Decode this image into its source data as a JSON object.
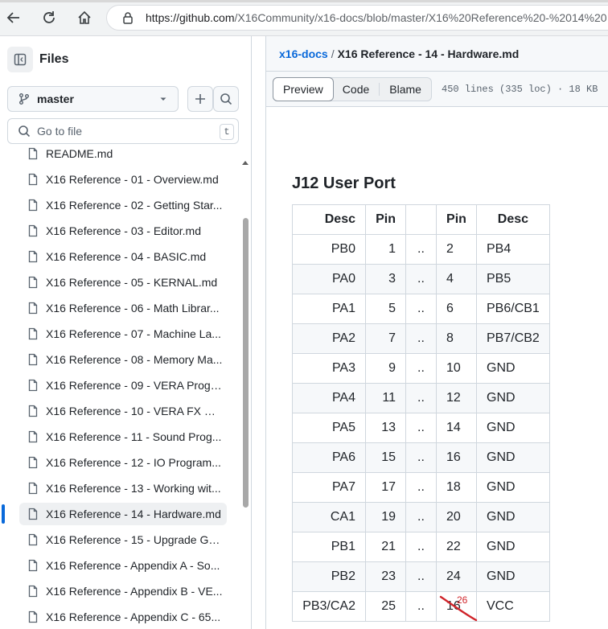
{
  "browser": {
    "url_host": "https://github.com",
    "url_path": "/X16Community/x16-docs/blob/master/X16%20Reference%20-%2014%20"
  },
  "sidebar": {
    "title": "Files",
    "branch": "master",
    "goto_placeholder": "Go to file",
    "goto_shortcut": "t",
    "files": [
      "README.md",
      "X16 Reference - 01 - Overview.md",
      "X16 Reference - 02 - Getting Star...",
      "X16 Reference - 03 - Editor.md",
      "X16 Reference - 04 - BASIC.md",
      "X16 Reference - 05 - KERNAL.md",
      "X16 Reference - 06 - Math Librar...",
      "X16 Reference - 07 - Machine La...",
      "X16 Reference - 08 - Memory Ma...",
      "X16 Reference - 09 - VERA Progr...",
      "X16 Reference - 10 - VERA FX Ref...",
      "X16 Reference - 11 - Sound Prog...",
      "X16 Reference - 12 - IO Program...",
      "X16 Reference - 13 - Working wit...",
      "X16 Reference - 14 - Hardware.md",
      "X16 Reference - 15 - Upgrade Gu...",
      "X16 Reference - Appendix A - So...",
      "X16 Reference - Appendix B - VE...",
      "X16 Reference - Appendix C - 65..."
    ],
    "active_index": 14
  },
  "main": {
    "breadcrumb_repo": "x16-docs",
    "breadcrumb_sep": "/",
    "breadcrumb_file": "X16 Reference - 14 - Hardware.md",
    "tabs": [
      "Preview",
      "Code",
      "Blame"
    ],
    "file_meta": "450 lines (335 loc) · 18 KB",
    "heading": "J12 User Port",
    "table_headers": [
      "Desc",
      "Pin",
      "",
      "Pin",
      "Desc"
    ],
    "rows": [
      [
        "PB0",
        "1",
        "..",
        "2",
        "PB4"
      ],
      [
        "PA0",
        "3",
        "..",
        "4",
        "PB5"
      ],
      [
        "PA1",
        "5",
        "..",
        "6",
        "PB6/CB1"
      ],
      [
        "PA2",
        "7",
        "..",
        "8",
        "PB7/CB2"
      ],
      [
        "PA3",
        "9",
        "..",
        "10",
        "GND"
      ],
      [
        "PA4",
        "11",
        "..",
        "12",
        "GND"
      ],
      [
        "PA5",
        "13",
        "..",
        "14",
        "GND"
      ],
      [
        "PA6",
        "15",
        "..",
        "16",
        "GND"
      ],
      [
        "PA7",
        "17",
        "..",
        "18",
        "GND"
      ],
      [
        "CA1",
        "19",
        "..",
        "20",
        "GND"
      ],
      [
        "PB1",
        "21",
        "..",
        "22",
        "GND"
      ],
      [
        "PB2",
        "23",
        "..",
        "24",
        "GND"
      ],
      [
        "PB3/CA2",
        "25",
        "..",
        "16",
        "VCC"
      ]
    ],
    "annotation": "26"
  },
  "colors": {
    "link": "#0969da",
    "active_marker": "#0969da",
    "annotation": "#d0242a"
  }
}
